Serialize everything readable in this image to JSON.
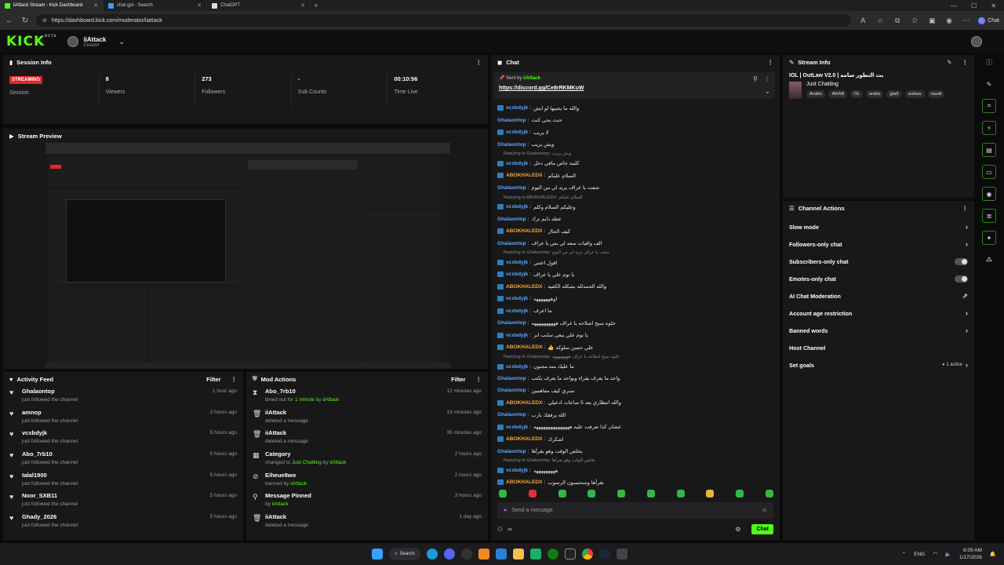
{
  "browser": {
    "tabs": [
      {
        "label": "iiAttack Stream - Kick Dashboard",
        "icon": "kick-icon",
        "active": true
      },
      {
        "label": "chat gpt - Search",
        "icon": "search-icon",
        "active": false
      },
      {
        "label": "ChatGPT",
        "icon": "chatgpt-icon",
        "active": false
      }
    ],
    "url": "https://dashboard.kick.com/moderator/iiattack",
    "copilot_label": "Chat"
  },
  "header": {
    "logo": "KICK",
    "logo_badge": "BETA",
    "channel_name": "iiAttack",
    "channel_role": "Creator"
  },
  "session": {
    "title": "Session Info",
    "status": "STREAMING",
    "stats": [
      {
        "value": "",
        "label": "Session"
      },
      {
        "value": "8",
        "label": "Viewers"
      },
      {
        "value": "273",
        "label": "Followers"
      },
      {
        "value": "-",
        "label": "Sub Counts"
      },
      {
        "value": "00:10:56",
        "label": "Time Live"
      }
    ]
  },
  "preview": {
    "title": "Stream Preview"
  },
  "activity": {
    "title": "Activity Feed",
    "filter": "Filter",
    "items": [
      {
        "name": "Ghalaontop",
        "sub": "just followed the channel",
        "time": "1 hour ago"
      },
      {
        "name": "amnop",
        "sub": "just followed the channel",
        "time": "2 hours ago"
      },
      {
        "name": "vcxbdyjk",
        "sub": "just followed the channel",
        "time": "5 hours ago"
      },
      {
        "name": "Abo_7rb10",
        "sub": "just followed the channel",
        "time": "5 hours ago"
      },
      {
        "name": "talal1900",
        "sub": "just followed the channel",
        "time": "5 hours ago"
      },
      {
        "name": "Noor_SXB11",
        "sub": "just followed the channel",
        "time": "5 hours ago"
      },
      {
        "name": "Ghady_2026",
        "sub": "just followed the channel",
        "time": "5 hours ago"
      }
    ]
  },
  "mod": {
    "title": "Mod Actions",
    "filter": "Filter",
    "items": [
      {
        "icon": "hourglass-icon",
        "name": "Abo_7rb10",
        "pre": "timed out for ",
        "mid": "1 minute",
        "midjoin": " by ",
        "by": "iiAttack",
        "time": "12 minutes ago"
      },
      {
        "icon": "trash-icon",
        "name": "iiAttack",
        "pre": "deleted a message",
        "mid": "",
        "midjoin": "",
        "by": "",
        "time": "13 minutes ago"
      },
      {
        "icon": "trash-icon",
        "name": "iiAttack",
        "pre": "deleted a message",
        "mid": "",
        "midjoin": "",
        "by": "",
        "time": "35 minutes ago"
      },
      {
        "icon": "category-icon",
        "name": "Category",
        "pre": "changed to ",
        "mid": "Just Chatting",
        "midjoin": " by ",
        "by": "iiAttack",
        "time": "2 hours ago"
      },
      {
        "icon": "ban-icon",
        "name": "Eiheue8wo",
        "pre": "banned by ",
        "mid": "",
        "midjoin": "",
        "by": "iiAttack",
        "time": "2 hours ago"
      },
      {
        "icon": "pin-icon",
        "name": "Message Pinned",
        "pre": "by ",
        "mid": "",
        "midjoin": "",
        "by": "iiAttack",
        "time": "3 hours ago"
      },
      {
        "icon": "trash-icon",
        "name": "iiAttack",
        "pre": "deleted a message",
        "mid": "",
        "midjoin": "",
        "by": "",
        "time": "1 day ago"
      }
    ]
  },
  "chat": {
    "title": "Chat",
    "pinned_label": "Sent by",
    "pinned_by": "iiAttack",
    "pinned_link": "https://discord.gg/Ce8rRKMKuW",
    "placeholder": "Send a message",
    "send": "Chat",
    "colors": {
      "blue": "#5aa7ff",
      "green": "#53fc18",
      "orange": "#f4a340",
      "gray": "#8a8a8a"
    },
    "messages": [
      {
        "type": "msg",
        "user": "vcxbdyjk",
        "color": "#5aa7ff",
        "badge": true,
        "text": "والله ما يجيبها لو ايش"
      },
      {
        "type": "msg",
        "user": "Ghalaontop",
        "color": "#5aa7ff",
        "badge": false,
        "text": "جنت يحي كنت"
      },
      {
        "type": "msg",
        "user": "vcxbdyjk",
        "color": "#5aa7ff",
        "badge": true,
        "text": "لا يريب"
      },
      {
        "type": "msg",
        "user": "Ghalaontop",
        "color": "#5aa7ff",
        "badge": false,
        "text": "ويش يريب"
      },
      {
        "type": "reply",
        "text": "Replying to Ghalaontop: ويش يريب"
      },
      {
        "type": "msg",
        "user": "vcxbdyjk",
        "color": "#5aa7ff",
        "badge": true,
        "text": "كلمه خاص مافي دخل"
      },
      {
        "type": "msg",
        "user": "ABOKHALEDX",
        "color": "#f4a340",
        "badge": true,
        "text": "السلام عليكم"
      },
      {
        "type": "msg",
        "user": "Ghalaontop",
        "color": "#5aa7ff",
        "badge": false,
        "text": "شفت يا عراف يزيد لي من اليوم"
      },
      {
        "type": "reply",
        "text": "Replying to ABOKHALEDX: السلام عليكم"
      },
      {
        "type": "msg",
        "user": "vcxbdyjk",
        "color": "#5aa7ff",
        "badge": true,
        "text": "وعليكم السلام وكلم"
      },
      {
        "type": "msg",
        "user": "Ghalaontop",
        "color": "#5aa7ff",
        "badge": false,
        "text": "عطه دايم ترك"
      },
      {
        "type": "msg",
        "user": "ABOKHALEDX",
        "color": "#f4a340",
        "badge": true,
        "text": "كيف الحال"
      },
      {
        "type": "msg",
        "user": "Ghalaontop",
        "color": "#5aa7ff",
        "badge": false,
        "text": "الف واقيات سعد لي بس يا عراف"
      },
      {
        "type": "reply",
        "text": "Replying to Ghalaontop: شفت يا عراف يزيد لي من اليوم"
      },
      {
        "type": "msg",
        "user": "vcxbdyjk",
        "color": "#5aa7ff",
        "badge": true,
        "text": "اقول اعتني"
      },
      {
        "type": "msg",
        "user": "vcxbdyjk",
        "color": "#5aa7ff",
        "badge": true,
        "text": "يا نوم علي يا عراف"
      },
      {
        "type": "msg",
        "user": "ABOKHALEDX",
        "color": "#f4a340",
        "badge": true,
        "text": "والله الحمدلله بشكله الكفيه"
      },
      {
        "type": "msg",
        "user": "vcxbdyjk",
        "color": "#5aa7ff",
        "badge": true,
        "text": "اوهههههههه"
      },
      {
        "type": "msg",
        "user": "vcxbdyjk",
        "color": "#5aa7ff",
        "badge": true,
        "text": "ما اعرف"
      },
      {
        "type": "msg",
        "user": "Ghalaontop",
        "color": "#5aa7ff",
        "badge": false,
        "text": "خلوه سبح اصلاحه يا عراف ههههههههههه"
      },
      {
        "type": "msg",
        "user": "vcxbdyjk",
        "color": "#5aa7ff",
        "badge": true,
        "text": "يا نوم علي يبغى سايب ابز"
      },
      {
        "type": "msg",
        "user": "ABOKHALEDX",
        "color": "#f4a340",
        "badge": true,
        "text": "علي حسن سلوكه 👍"
      },
      {
        "type": "reply",
        "text": "Replying to Ghalaontop: خلوه سبح اصلاحه يا عراف ههههههههه"
      },
      {
        "type": "msg",
        "user": "vcxbdyjk",
        "color": "#5aa7ff",
        "badge": true,
        "text": "ما عليك منه مجنون"
      },
      {
        "type": "msg",
        "user": "Ghalaontop",
        "color": "#5aa7ff",
        "badge": false,
        "text": "واحد ما يعرف يقراء ويواحد ما يعرف يكتب"
      },
      {
        "type": "msg",
        "user": "Ghalaontop",
        "color": "#5aa7ff",
        "badge": false,
        "text": "سنري كيف مفاهمين"
      },
      {
        "type": "msg",
        "user": "ABOKHALEDX",
        "color": "#f4a340",
        "badge": true,
        "text": "والله انتظاري بعد 5 ساعات ادعيلي"
      },
      {
        "type": "msg",
        "user": "Ghalaontop",
        "color": "#5aa7ff",
        "badge": false,
        "text": "الله يرفقك بارب"
      },
      {
        "type": "msg",
        "user": "vcxbdyjk",
        "color": "#5aa7ff",
        "badge": true,
        "text": "عشان كذا تعرفت عليه هههههههههههههههه"
      },
      {
        "type": "msg",
        "user": "ABOKHALEDX",
        "color": "#f4a340",
        "badge": true,
        "text": "اشكرك"
      },
      {
        "type": "msg",
        "user": "Ghalaontop",
        "color": "#5aa7ff",
        "badge": false,
        "text": "يخلص الوقت وهو يقرأها"
      },
      {
        "type": "reply",
        "text": "Replying to Ghalaontop: يخلص الوقت وهو يقرأها"
      },
      {
        "type": "msg",
        "user": "vcxbdyjk",
        "color": "#5aa7ff",
        "badge": true,
        "text": "هههههههههه"
      },
      {
        "type": "msg",
        "user": "ABOKHALEDX",
        "color": "#f4a340",
        "badge": true,
        "text": "تقرأها وسحسبون الرسوب"
      }
    ]
  },
  "stream_info": {
    "title": "Stream Info",
    "stream_title": "IOL | OutLaw V2.0 | بث التطور سامه",
    "category": "Just Chatting",
    "tags": [
      "Arabic",
      "ARAB",
      "OL",
      "arabs",
      "gta5",
      "outlaw",
      "saudi"
    ]
  },
  "channel_actions": {
    "title": "Channel Actions",
    "items": [
      {
        "label": "Slow mode",
        "control": "chevron"
      },
      {
        "label": "Followers-only chat",
        "control": "chevron"
      },
      {
        "label": "Subscribers-only chat",
        "control": "toggle"
      },
      {
        "label": "Emotes-only chat",
        "control": "toggle"
      },
      {
        "label": "AI Chat Moderation",
        "control": "external"
      },
      {
        "label": "Account age restriction",
        "control": "chevron"
      },
      {
        "label": "Banned words",
        "control": "chevron"
      },
      {
        "label": "Host Channel",
        "control": "none"
      },
      {
        "label": "Set goals",
        "control": "goals",
        "extra": "1 active"
      }
    ]
  },
  "taskbar": {
    "search": "Search",
    "time": "6:09 AM",
    "date": "1/17/2026",
    "lang": "ENG"
  }
}
